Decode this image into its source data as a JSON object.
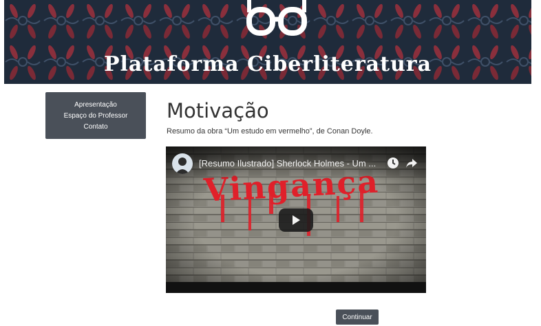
{
  "banner": {
    "title": "Plataforma Ciberliteratura",
    "logo_icon": "glasses-icon"
  },
  "menu": {
    "items": [
      {
        "label": "Apresentação"
      },
      {
        "label": "Espaço do Professor"
      },
      {
        "label": "Contato"
      }
    ]
  },
  "main": {
    "title": "Motivação",
    "description": "Resumo da obra “Um estudo em vermelho”, de Conan Doyle."
  },
  "video": {
    "title": "[Resumo Ilustrado] Sherlock Holmes - Um ...",
    "overlay_text": "Vingança",
    "icons": [
      "channel-avatar",
      "watch-later-icon",
      "share-icon",
      "play-icon"
    ]
  },
  "actions": {
    "continue_label": "Continuar"
  },
  "colors": {
    "banner_bg": "#1f2b3b",
    "menu_bg": "#4a5059",
    "overlay_red": "#e0202a"
  }
}
